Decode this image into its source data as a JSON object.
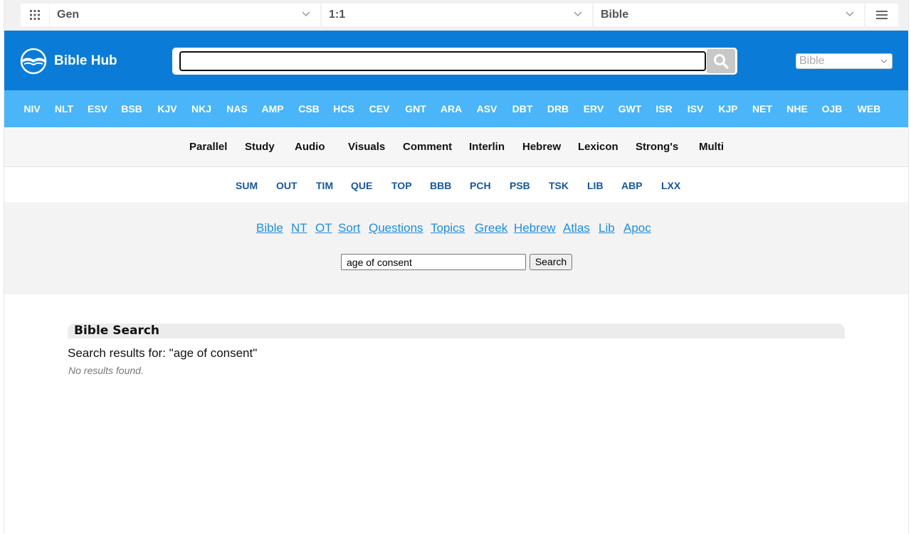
{
  "topbar": {
    "book": "Gen",
    "chapter": "1:1",
    "version": "Bible"
  },
  "header": {
    "logo_text": "Bible Hub",
    "search_value": "",
    "select_value": "Bible"
  },
  "versions": [
    "NIV",
    "NLT",
    "ESV",
    "BSB",
    "KJV",
    "NKJ",
    "NAS",
    "AMP",
    "CSB",
    "HCS",
    "CEV",
    "GNT",
    "ARA",
    "ASV",
    "DBT",
    "DRB",
    "ERV",
    "GWT",
    "ISR",
    "ISV",
    "KJP",
    "NET",
    "NHE",
    "OJB",
    "WEB"
  ],
  "tools": [
    "Parallel",
    "Study",
    "Audio",
    "Visuals",
    "Comment",
    "Interlin",
    "Hebrew",
    "Lexicon",
    "Strong's",
    "Multi"
  ],
  "abbrev": [
    "SUM",
    "OUT",
    "TIM",
    "QUE",
    "TOP",
    "BBB",
    "PCH",
    "PSB",
    "TSK",
    "LIB",
    "ABP",
    "LXX"
  ],
  "links": [
    "Bible",
    "NT",
    "OT",
    "Sort",
    "Questions",
    "Topics",
    "Greek",
    "Hebrew",
    "Atlas",
    "Lib",
    "Apoc"
  ],
  "query": {
    "value": "age of consent",
    "button": "Search"
  },
  "results": {
    "heading": "Bible Search",
    "summary": "Search results for: \"age of consent\"",
    "empty": "No results found."
  },
  "colors": {
    "header_blue": "#0a7cd8",
    "nav_blue": "#4ab5f8",
    "link_blue": "#1f8de0",
    "abbrev_blue": "#16579c"
  }
}
